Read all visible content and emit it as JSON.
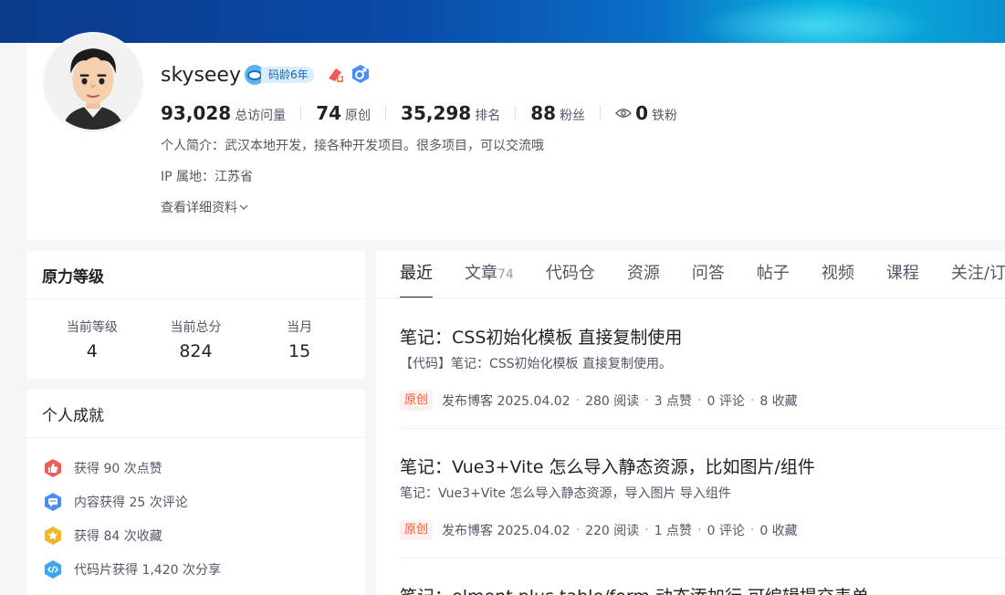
{
  "profile": {
    "username": "skyseey",
    "code_age": "码龄6年",
    "stats": [
      {
        "num": "93,028",
        "label": "总访问量"
      },
      {
        "num": "74",
        "label": "原创"
      },
      {
        "num": "35,298",
        "label": "排名"
      },
      {
        "num": "88",
        "label": "粉丝"
      },
      {
        "num": "0",
        "label": "铁粉"
      }
    ],
    "bio": "个人简介：武汉本地开发，接各种开发项目。很多项目，可以交流哦",
    "ip": "IP 属地：江苏省",
    "more": "查看详细资料"
  },
  "level": {
    "title": "原力等级",
    "items": [
      {
        "key": "当前等级",
        "value": "4"
      },
      {
        "key": "当前总分",
        "value": "824"
      },
      {
        "key": "当月",
        "value": "15"
      }
    ]
  },
  "achievements": {
    "title": "个人成就",
    "items": [
      {
        "text": "获得 90 次点赞",
        "icon": "thumbs-up-icon",
        "color": "#f05a5a"
      },
      {
        "text": "内容获得 25 次评论",
        "icon": "comment-icon",
        "color": "#4a8df5"
      },
      {
        "text": "获得 84 次收藏",
        "icon": "star-icon",
        "color": "#f5b326"
      },
      {
        "text": "代码片获得 1,420 次分享",
        "icon": "code-icon",
        "color": "#3aa6f0"
      }
    ]
  },
  "tabs": [
    {
      "label": "最近",
      "count": ""
    },
    {
      "label": "文章",
      "count": "74"
    },
    {
      "label": "代码仓",
      "count": ""
    },
    {
      "label": "资源",
      "count": ""
    },
    {
      "label": "问答",
      "count": ""
    },
    {
      "label": "帖子",
      "count": ""
    },
    {
      "label": "视频",
      "count": ""
    },
    {
      "label": "课程",
      "count": ""
    },
    {
      "label": "关注/订阅",
      "count": ""
    }
  ],
  "articles": [
    {
      "title": "笔记：CSS初始化模板 直接复制使用",
      "desc": "【代码】笔记：CSS初始化模板 直接复制使用。",
      "tag": "原创",
      "date": "发布博客 2025.04.02",
      "reads": "280 阅读",
      "likes": "3 点赞",
      "comments": "0 评论",
      "favs": "8 收藏"
    },
    {
      "title": "笔记：Vue3+Vite 怎么导入静态资源，比如图片/组件",
      "desc": "笔记：Vue3+Vite 怎么导入静态资源，导入图片 导入组件",
      "tag": "原创",
      "date": "发布博客 2025.04.02",
      "reads": "220 阅读",
      "likes": "1 点赞",
      "comments": "0 评论",
      "favs": "0 收藏"
    },
    {
      "title": "笔记：elment plus table/form 动态添加行 可编辑提交表单",
      "desc": "",
      "tag": "",
      "date": "",
      "reads": "",
      "likes": "",
      "comments": "",
      "favs": ""
    }
  ],
  "colors": {
    "accent": "#fc5531",
    "banner": "#0a4aa8"
  }
}
